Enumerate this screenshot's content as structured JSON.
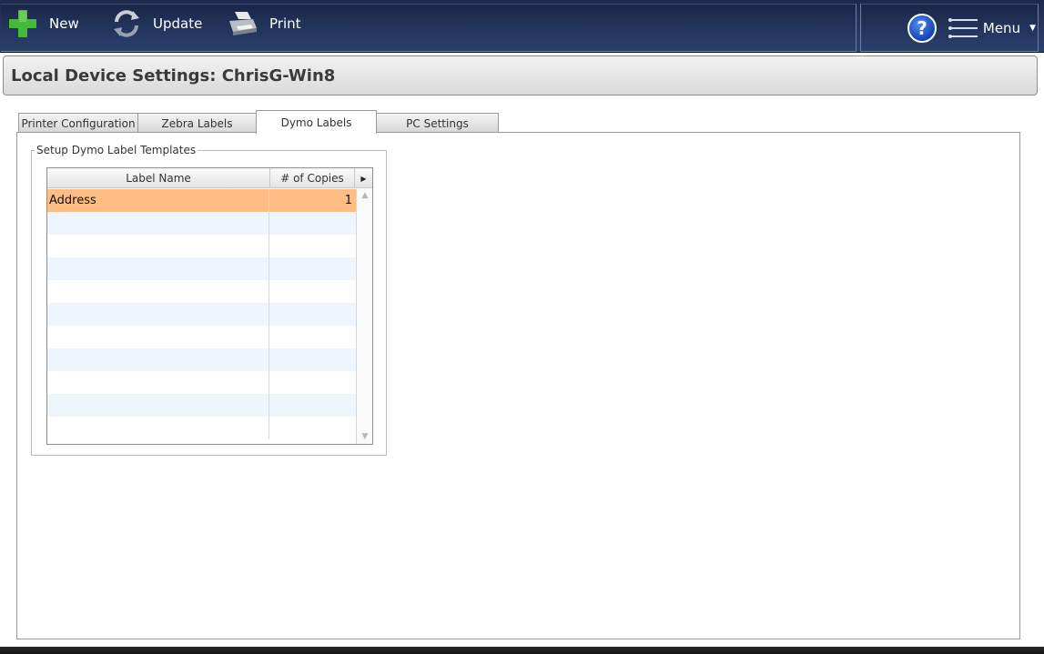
{
  "toolbar": {
    "new_label": "New",
    "update_label": "Update",
    "print_label": "Print",
    "help_label": "?",
    "menu_label": "Menu"
  },
  "title": "Local Device Settings: ChrisG-Win8",
  "tabs": [
    {
      "label": "Printer Configuration",
      "active": false
    },
    {
      "label": "Zebra Labels",
      "active": false
    },
    {
      "label": "Dymo Labels",
      "active": true
    },
    {
      "label": "PC Settings",
      "active": false
    }
  ],
  "group": {
    "legend": "Setup Dymo Label Templates",
    "grid": {
      "columns": [
        "Label Name",
        "# of Copies"
      ],
      "rows": [
        {
          "label_name": "Address",
          "copies": "1",
          "selected": true
        }
      ]
    }
  },
  "colors": {
    "toolbar_bg": "#24345a",
    "selected_row": "#fdbd84",
    "alt_row": "#eef5fc",
    "add_icon": "#46b83a"
  },
  "icons": {
    "new": "plus-icon",
    "update": "refresh-icon",
    "print": "printer-icon",
    "help": "question-icon",
    "menu": "list-menu-icon"
  }
}
